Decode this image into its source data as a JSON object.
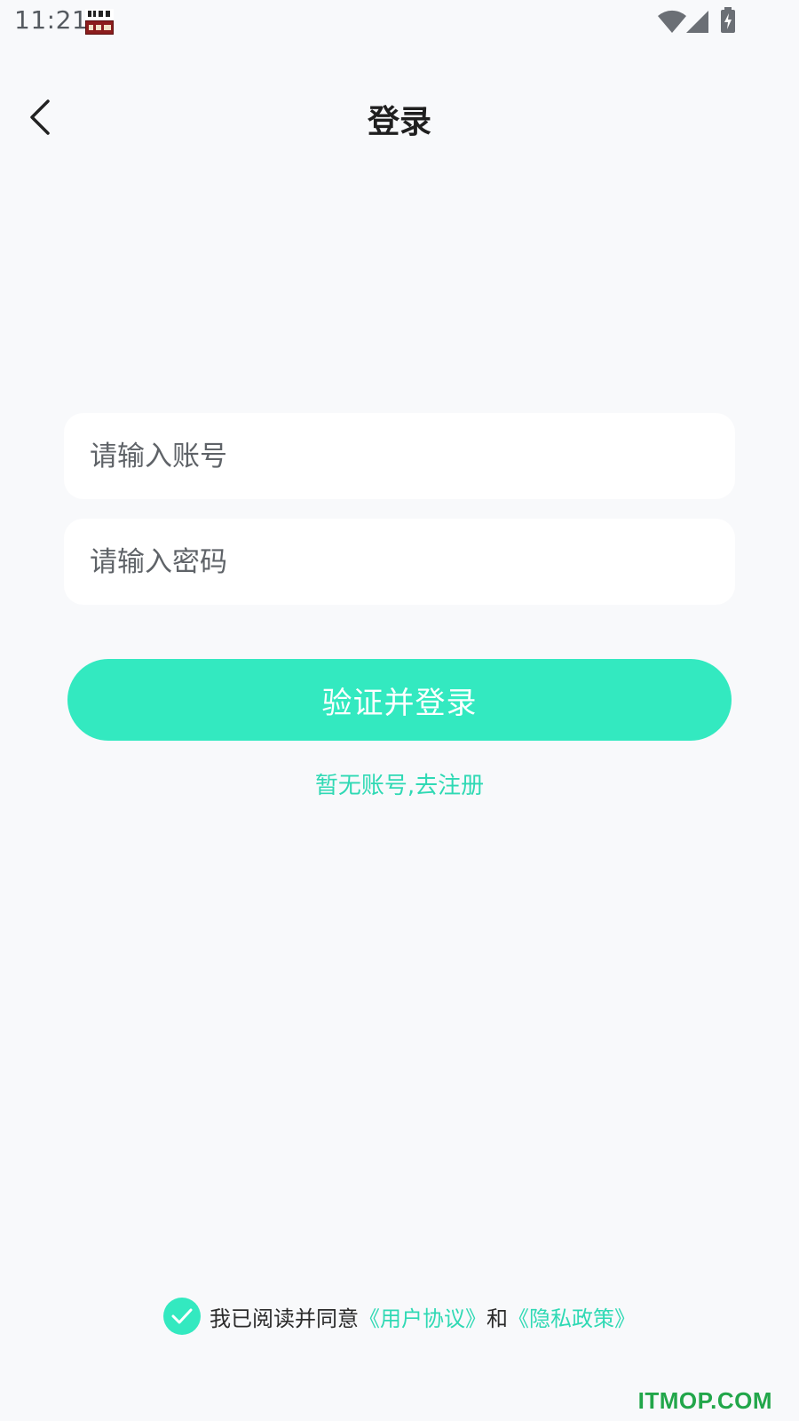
{
  "status_bar": {
    "time": "11:21",
    "icons": [
      "app-badge-icon",
      "wifi-icon",
      "signal-icon",
      "battery-charging-icon"
    ]
  },
  "header": {
    "title": "登录",
    "back_icon": "chevron-left-icon"
  },
  "form": {
    "account_placeholder": "请输入账号",
    "account_value": "",
    "password_placeholder": "请输入密码",
    "password_value": "",
    "submit_label": "验证并登录",
    "register_label": "暂无账号,去注册"
  },
  "agreement": {
    "checked": true,
    "prefix": "我已阅读并同意",
    "user_agreement": "《用户协议》",
    "conjunction": "和",
    "privacy_policy": "《隐私政策》"
  },
  "watermark": "ITMOP.COM",
  "colors": {
    "accent": "#33e9c0",
    "link": "#2fd9b4",
    "background": "#f8f9fb",
    "field_bg": "#ffffff",
    "watermark": "#22a64a"
  }
}
